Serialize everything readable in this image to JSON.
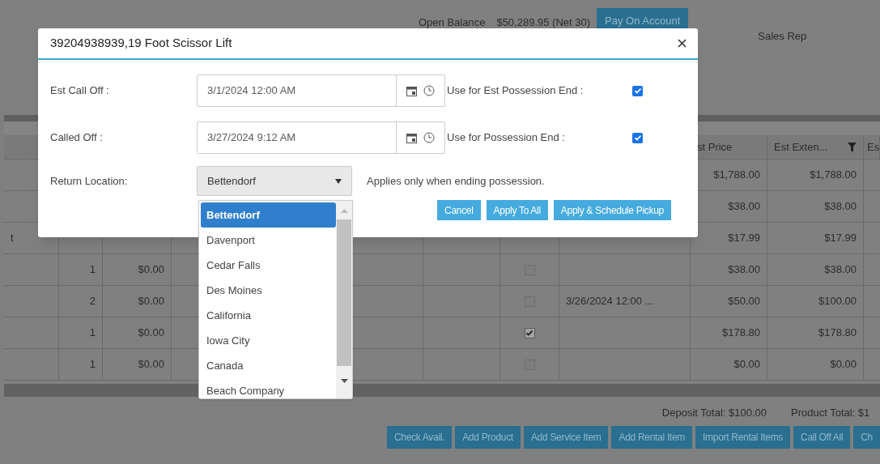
{
  "header": {
    "balance_label": "Open Balance",
    "balance_value": "$50,289.95 (Net 30)",
    "pay_button": "Pay On Account",
    "sales_rep_label": "Sales Rep"
  },
  "table": {
    "columns": [
      {
        "label": "st Price",
        "filter": false
      },
      {
        "label": "Est Exten...",
        "filter": true
      },
      {
        "label": "Es",
        "filter": false
      }
    ],
    "rows": [
      {
        "est_price": "$1,788.00",
        "est_extended": "$1,788.00"
      },
      {
        "est_price": "$38.00",
        "est_extended": "$38.00"
      },
      {
        "column_1": "t",
        "est_price": "$17.99",
        "est_extended": "$17.99"
      },
      {
        "column_2": "1",
        "column_3": "$0.00",
        "checked": false,
        "est_price": "$38.00",
        "est_extended": "$38.00"
      },
      {
        "column_2": "2",
        "column_3": "$0.00",
        "checked": false,
        "column_7": "3/26/2024 12:00 ...",
        "est_price": "$50.00",
        "est_extended": "$100.00"
      },
      {
        "column_2": "1",
        "column_3": "$0.00",
        "checked": true,
        "est_price": "$178.80",
        "est_extended": "$178.80"
      },
      {
        "column_2": "1",
        "column_3": "$0.00",
        "checked": false,
        "est_price": "$0.00",
        "est_extended": "$0.00"
      }
    ]
  },
  "footer": {
    "deposit_total": "Deposit Total: $100.00",
    "product_total": "Product Total: $1",
    "buttons": [
      "Check Avail.",
      "Add Product",
      "Add Service Item",
      "Add Rental Item",
      "Import Rental Items",
      "Call Off All",
      "Ch"
    ]
  },
  "dialog": {
    "title": "39204938939,19 Foot Scissor Lift",
    "fields": [
      {
        "label": "Est Call Off :",
        "value": "3/1/2024 12:00 AM",
        "option_label": "Use for Est Possession End :",
        "checked": true
      },
      {
        "label": "Called Off :",
        "value": "3/27/2024 9:12 AM",
        "option_label": "Use for Possession End :",
        "checked": true
      }
    ],
    "return_location": {
      "label": "Return Location:",
      "value": "Bettendorf",
      "note": "Applies only when ending possession.",
      "expanded": true,
      "options": [
        {
          "label": "Bettendorf",
          "selected": true
        },
        {
          "label": "Davenport",
          "selected": false
        },
        {
          "label": "Cedar Falls",
          "selected": false
        },
        {
          "label": "Des Moines",
          "selected": false
        },
        {
          "label": "California",
          "selected": false
        },
        {
          "label": "Iowa City",
          "selected": false
        },
        {
          "label": "Canada",
          "selected": false
        },
        {
          "label": "Beach Company",
          "selected": false
        }
      ]
    },
    "buttons": [
      "Cancel",
      "Apply To All",
      "Apply & Schedule Pickup"
    ]
  }
}
